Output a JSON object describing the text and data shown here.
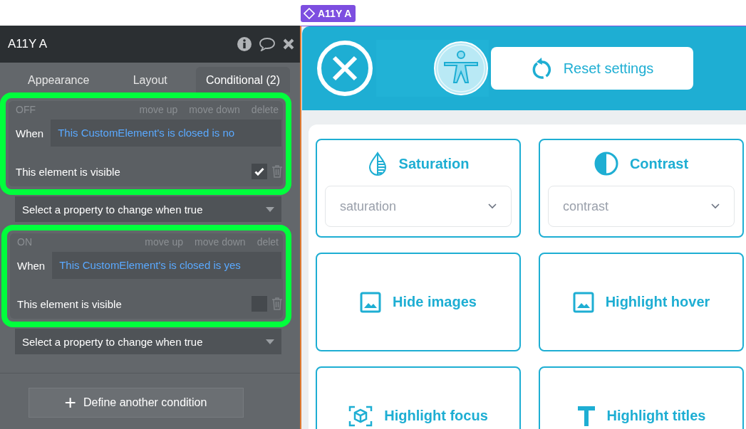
{
  "badge": {
    "label": "A11Y A"
  },
  "panel": {
    "title": "A11Y A",
    "tabs": [
      {
        "label": "Appearance",
        "selected": false
      },
      {
        "label": "Layout",
        "selected": false
      },
      {
        "label": "Conditional (2)",
        "selected": true
      }
    ],
    "conditions": [
      {
        "status": "OFF",
        "highlighted": true,
        "actions": [
          "move up",
          "move down",
          "delete"
        ],
        "when_label": "When",
        "expression": "This CustomElement's is closed is no",
        "property": "This element is visible",
        "checked": true,
        "select_placeholder": "Select a property to change when true"
      },
      {
        "status": "ON",
        "highlighted": true,
        "actions": [
          "move up",
          "move down",
          "delet"
        ],
        "when_label": "When",
        "expression": "This CustomElement's is closed is yes",
        "property": "This element is visible",
        "checked": false,
        "select_placeholder": "Select a property to change when true"
      }
    ],
    "add_button": {
      "icon": "+",
      "label": "Define another condition"
    }
  },
  "widget": {
    "reset_button": "Reset settings",
    "tiles": [
      {
        "kind": "dropdown",
        "title": "Saturation",
        "placeholder": "saturation"
      },
      {
        "kind": "dropdown",
        "title": "Contrast",
        "placeholder": "contrast"
      },
      {
        "kind": "toggle",
        "title": "Hide images"
      },
      {
        "kind": "toggle",
        "title": "Highlight hover"
      },
      {
        "kind": "toggle",
        "title": "Highlight focus"
      },
      {
        "kind": "toggle",
        "title": "Highlight titles"
      }
    ]
  }
}
